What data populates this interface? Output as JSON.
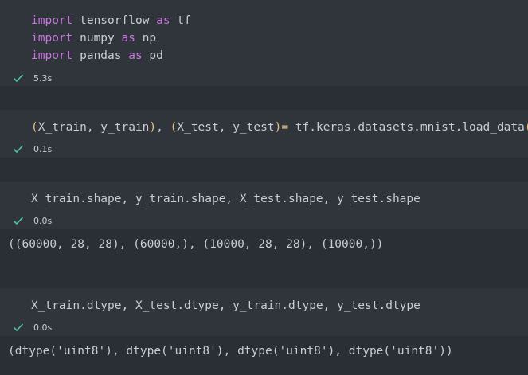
{
  "cells": [
    {
      "lines": [
        [
          {
            "t": "import",
            "k": "kw"
          },
          {
            "t": " tensorflow ",
            "k": ""
          },
          {
            "t": "as",
            "k": "kw"
          },
          {
            "t": " tf",
            "k": ""
          }
        ],
        [
          {
            "t": "import",
            "k": "kw"
          },
          {
            "t": " numpy ",
            "k": ""
          },
          {
            "t": "as",
            "k": "kw"
          },
          {
            "t": " np",
            "k": ""
          }
        ],
        [
          {
            "t": "import",
            "k": "kw"
          },
          {
            "t": " pandas ",
            "k": ""
          },
          {
            "t": "as",
            "k": "kw"
          },
          {
            "t": " pd",
            "k": ""
          }
        ]
      ],
      "time": "5.3s"
    },
    {
      "lines": [
        [
          {
            "t": "(",
            "k": "br"
          },
          {
            "t": "X_train, y_train",
            "k": ""
          },
          {
            "t": ")",
            "k": "br"
          },
          {
            "t": ", ",
            "k": ""
          },
          {
            "t": "(",
            "k": "br"
          },
          {
            "t": "X_test, y_test",
            "k": ""
          },
          {
            "t": ")",
            "k": "br"
          },
          {
            "t": "= ",
            "k": "op"
          },
          {
            "t": "tf.keras.datasets.mnist.load_data",
            "k": ""
          },
          {
            "t": "()",
            "k": "br"
          }
        ]
      ],
      "time": "0.1s"
    },
    {
      "lines": [
        [
          {
            "t": "X_train.shape, y_train.shape, X_test.shape, y_test.shape",
            "k": ""
          }
        ]
      ],
      "time": "0.0s",
      "output": "((60000, 28, 28), (60000,), (10000, 28, 28), (10000,))"
    },
    {
      "lines": [
        [
          {
            "t": "X_train.dtype, X_test.dtype, y_train.dtype, y_test.dtype",
            "k": ""
          }
        ]
      ],
      "time": "0.0s",
      "output": "(dtype('uint8'), dtype('uint8'), dtype('uint8'), dtype('uint8'))"
    }
  ],
  "colors": {
    "background": "#2a2e35",
    "code_background": "#30343b",
    "keyword": "#c678dd",
    "bracket": "#e5c07b",
    "text": "#c9cdd3",
    "check": "#4ec9a0"
  },
  "icons": {
    "status": "checkmark-icon"
  }
}
